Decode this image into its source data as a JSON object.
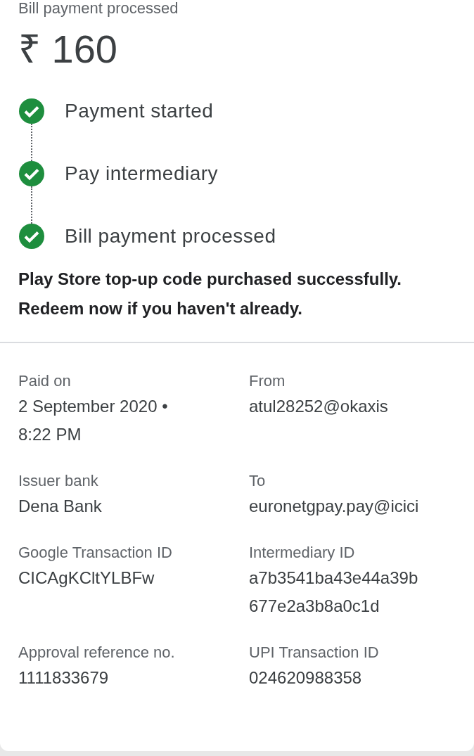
{
  "header": {
    "title": "Bill payment processed",
    "amount": "₹ 160"
  },
  "steps": [
    {
      "label": "Payment started",
      "done": true
    },
    {
      "label": "Pay intermediary",
      "done": true
    },
    {
      "label": "Bill payment processed",
      "done": true
    }
  ],
  "message": "Play Store top-up code purchased successfully. Redeem now if you haven't already.",
  "details": [
    {
      "label": "Paid on",
      "value": [
        "2 September 2020 •",
        "8:22 PM"
      ]
    },
    {
      "label": "From",
      "value": [
        "atul28252@okaxis"
      ]
    },
    {
      "label": "Issuer bank",
      "value": [
        "Dena Bank"
      ]
    },
    {
      "label": "To",
      "value": [
        "euronetgpay.pay@icici"
      ]
    },
    {
      "label": "Google Transaction ID",
      "value": [
        "CICAgKCltYLBFw"
      ]
    },
    {
      "label": "Intermediary ID",
      "value": [
        "a7b3541ba43e44a39b",
        "677e2a3b8a0c1d"
      ]
    },
    {
      "label": "Approval reference no.",
      "value": [
        "1111833679"
      ]
    },
    {
      "label": "UPI Transaction ID",
      "value": [
        "024620988358"
      ]
    }
  ]
}
